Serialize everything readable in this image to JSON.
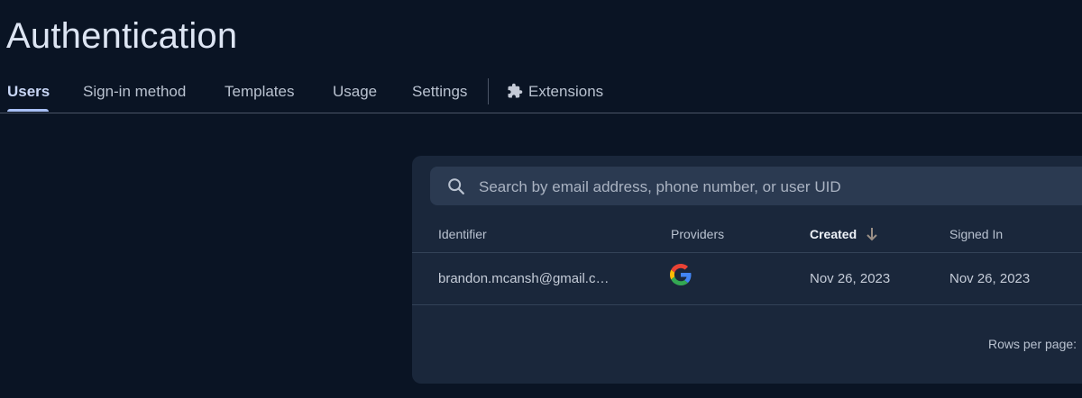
{
  "page": {
    "title": "Authentication"
  },
  "tabs": [
    {
      "label": "Users",
      "active": true
    },
    {
      "label": "Sign-in method",
      "active": false
    },
    {
      "label": "Templates",
      "active": false
    },
    {
      "label": "Usage",
      "active": false
    },
    {
      "label": "Settings",
      "active": false
    },
    {
      "label": "Extensions",
      "active": false,
      "icon": "extension-puzzle-icon"
    }
  ],
  "search": {
    "placeholder": "Search by email address, phone number, or user UID",
    "value": "",
    "icon": "search-icon"
  },
  "table": {
    "columns": [
      {
        "label": "Identifier"
      },
      {
        "label": "Providers"
      },
      {
        "label": "Created",
        "sorted": "descending",
        "sort_icon": "arrow-down-icon"
      },
      {
        "label": "Signed In"
      }
    ],
    "rows": [
      {
        "identifier": "brandon.mcansh@gmail.c…",
        "provider_icon": "google-icon",
        "created": "Nov 26, 2023",
        "signed_in": "Nov 26, 2023"
      }
    ]
  },
  "pagination": {
    "rows_per_page_label": "Rows per page:"
  },
  "colors": {
    "background": "#0a1424",
    "card": "#1a273b",
    "search_field": "#2b3a51",
    "active_tab_indicator": "#a8c0f6"
  }
}
